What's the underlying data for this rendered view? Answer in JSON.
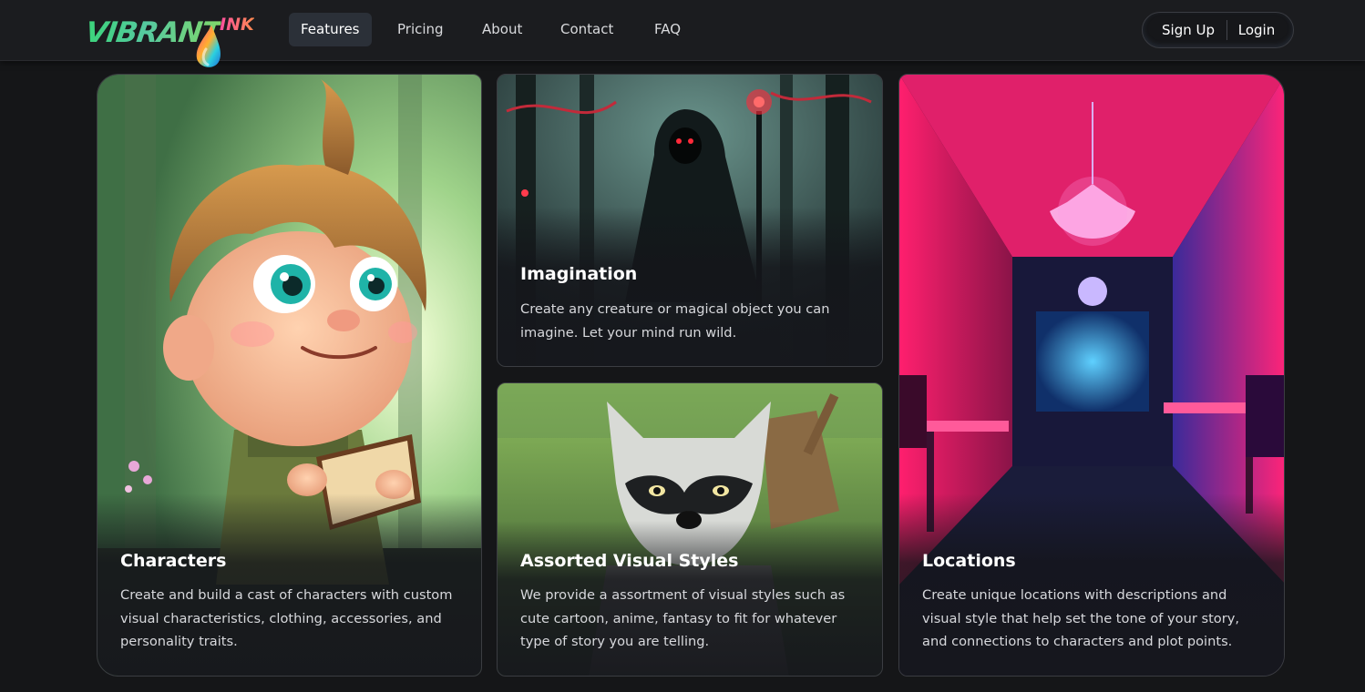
{
  "brand": {
    "logo_main": "VIBRANT",
    "logo_accent": "INK"
  },
  "nav": {
    "links": [
      {
        "label": "Features",
        "active": true
      },
      {
        "label": "Pricing",
        "active": false
      },
      {
        "label": "About",
        "active": false
      },
      {
        "label": "Contact",
        "active": false
      },
      {
        "label": "FAQ",
        "active": false
      }
    ],
    "signup_label": "Sign Up",
    "login_label": "Login"
  },
  "features": {
    "characters": {
      "title": "Characters",
      "description": "Create and build a cast of characters with custom visual characteristics, clothing, accessories, and personality traits.",
      "art_icon": "cartoon-boy-illustration"
    },
    "imagination": {
      "title": "Imagination",
      "description": "Create any creature or magical object you can imagine. Let your mind run wild.",
      "art_icon": "hooded-wizard-illustration"
    },
    "styles": {
      "title": "Assorted Visual Styles",
      "description": "We provide a assortment of visual styles such as cute cartoon, anime, fantasy to fit for whatever type of story you are telling.",
      "art_icon": "raccoon-illustration"
    },
    "locations": {
      "title": "Locations",
      "description": "Create unique locations with descriptions and visual style that help set the tone of your story, and connections to characters and plot points.",
      "art_icon": "neon-restaurant-illustration"
    }
  },
  "colors": {
    "background": "#151618",
    "nav_background": "#1b1c1f",
    "active_tab": "#2b3038",
    "accent_pink": "#ff3d8b",
    "accent_green": "#3bd47a"
  }
}
